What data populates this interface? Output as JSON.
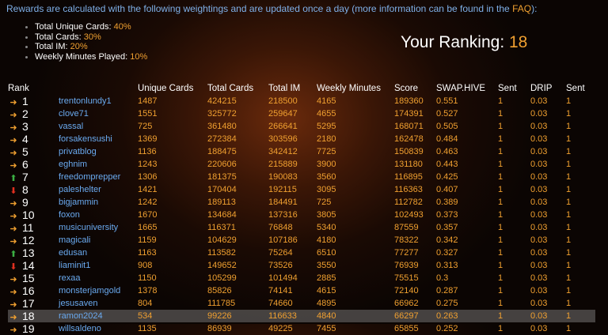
{
  "intro": {
    "text": "Rewards are calculated with the following weightings and are updated once a day (more information can be found in the ",
    "faq_label": "FAQ",
    "end": "):"
  },
  "weights": [
    {
      "label": "Total Unique Cards: ",
      "value": "40%"
    },
    {
      "label": "Total Cards: ",
      "value": "30%"
    },
    {
      "label": "Total IM: ",
      "value": "20%"
    },
    {
      "label": "Weekly Minutes Played: ",
      "value": "10%"
    }
  ],
  "ranking": {
    "label": "Your Ranking: ",
    "value": "18"
  },
  "headers": [
    "Rank",
    "Unique Cards",
    "Total Cards",
    "Total IM",
    "Weekly Minutes",
    "Score",
    "SWAP.HIVE",
    "Sent",
    "DRIP",
    "Sent"
  ],
  "rows": [
    {
      "arrow": "right",
      "rank": "1",
      "name": "trentonlundy1",
      "unique": "1487",
      "total": "424215",
      "im": "218500",
      "minutes": "4165",
      "score": "189360",
      "swap": "0.551",
      "sent": "1",
      "drip": "0.03",
      "sent2": "1"
    },
    {
      "arrow": "right",
      "rank": "2",
      "name": "clove71",
      "unique": "1551",
      "total": "325772",
      "im": "259647",
      "minutes": "4655",
      "score": "174391",
      "swap": "0.527",
      "sent": "1",
      "drip": "0.03",
      "sent2": "1"
    },
    {
      "arrow": "right",
      "rank": "3",
      "name": "vassal",
      "unique": "725",
      "total": "361480",
      "im": "266641",
      "minutes": "5295",
      "score": "168071",
      "swap": "0.505",
      "sent": "1",
      "drip": "0.03",
      "sent2": "1"
    },
    {
      "arrow": "right",
      "rank": "4",
      "name": "forsakensushi",
      "unique": "1369",
      "total": "272384",
      "im": "303596",
      "minutes": "2180",
      "score": "162478",
      "swap": "0.484",
      "sent": "1",
      "drip": "0.03",
      "sent2": "1"
    },
    {
      "arrow": "right",
      "rank": "5",
      "name": "privatblog",
      "unique": "1136",
      "total": "188475",
      "im": "342412",
      "minutes": "7725",
      "score": "150839",
      "swap": "0.463",
      "sent": "1",
      "drip": "0.03",
      "sent2": "1"
    },
    {
      "arrow": "right",
      "rank": "6",
      "name": "eghnim",
      "unique": "1243",
      "total": "220606",
      "im": "215889",
      "minutes": "3900",
      "score": "131180",
      "swap": "0.443",
      "sent": "1",
      "drip": "0.03",
      "sent2": "1"
    },
    {
      "arrow": "up",
      "rank": "7",
      "name": "freedomprepper",
      "unique": "1306",
      "total": "181375",
      "im": "190083",
      "minutes": "3560",
      "score": "116895",
      "swap": "0.425",
      "sent": "1",
      "drip": "0.03",
      "sent2": "1"
    },
    {
      "arrow": "down",
      "rank": "8",
      "name": "paleshelter",
      "unique": "1421",
      "total": "170404",
      "im": "192115",
      "minutes": "3095",
      "score": "116363",
      "swap": "0.407",
      "sent": "1",
      "drip": "0.03",
      "sent2": "1"
    },
    {
      "arrow": "right",
      "rank": "9",
      "name": "bigjammin",
      "unique": "1242",
      "total": "189113",
      "im": "184491",
      "minutes": "725",
      "score": "112782",
      "swap": "0.389",
      "sent": "1",
      "drip": "0.03",
      "sent2": "1"
    },
    {
      "arrow": "right",
      "rank": "10",
      "name": "foxon",
      "unique": "1670",
      "total": "134684",
      "im": "137316",
      "minutes": "3805",
      "score": "102493",
      "swap": "0.373",
      "sent": "1",
      "drip": "0.03",
      "sent2": "1"
    },
    {
      "arrow": "right",
      "rank": "11",
      "name": "musicuniversity",
      "unique": "1665",
      "total": "116371",
      "im": "76848",
      "minutes": "5340",
      "score": "87559",
      "swap": "0.357",
      "sent": "1",
      "drip": "0.03",
      "sent2": "1"
    },
    {
      "arrow": "right",
      "rank": "12",
      "name": "magicali",
      "unique": "1159",
      "total": "104629",
      "im": "107186",
      "minutes": "4180",
      "score": "78322",
      "swap": "0.342",
      "sent": "1",
      "drip": "0.03",
      "sent2": "1"
    },
    {
      "arrow": "up",
      "rank": "13",
      "name": "edusan",
      "unique": "1163",
      "total": "113582",
      "im": "75264",
      "minutes": "6510",
      "score": "77277",
      "swap": "0.327",
      "sent": "1",
      "drip": "0.03",
      "sent2": "1"
    },
    {
      "arrow": "down",
      "rank": "14",
      "name": "liaminit1",
      "unique": "908",
      "total": "149652",
      "im": "73526",
      "minutes": "3550",
      "score": "76939",
      "swap": "0.313",
      "sent": "1",
      "drip": "0.03",
      "sent2": "1"
    },
    {
      "arrow": "right",
      "rank": "15",
      "name": "rexaa",
      "unique": "1150",
      "total": "105299",
      "im": "101494",
      "minutes": "2885",
      "score": "75515",
      "swap": "0.3",
      "sent": "1",
      "drip": "0.03",
      "sent2": "1"
    },
    {
      "arrow": "right",
      "rank": "16",
      "name": "monsterjamgold",
      "unique": "1378",
      "total": "85826",
      "im": "74141",
      "minutes": "4615",
      "score": "72140",
      "swap": "0.287",
      "sent": "1",
      "drip": "0.03",
      "sent2": "1"
    },
    {
      "arrow": "right",
      "rank": "17",
      "name": "jesusaven",
      "unique": "804",
      "total": "111785",
      "im": "74660",
      "minutes": "4895",
      "score": "66962",
      "swap": "0.275",
      "sent": "1",
      "drip": "0.03",
      "sent2": "1"
    },
    {
      "arrow": "right",
      "rank": "18",
      "name": "ramon2024",
      "unique": "534",
      "total": "99226",
      "im": "116633",
      "minutes": "4840",
      "score": "66297",
      "swap": "0.263",
      "sent": "1",
      "drip": "0.03",
      "sent2": "1",
      "highlight": true
    },
    {
      "arrow": "right",
      "rank": "19",
      "name": "willsaldeno",
      "unique": "1135",
      "total": "86939",
      "im": "49225",
      "minutes": "7455",
      "score": "65855",
      "swap": "0.252",
      "sent": "1",
      "drip": "0.03",
      "sent2": "1"
    }
  ],
  "colors": {
    "accent": "#f0a030",
    "link": "#6aaaf0",
    "up": "#3cb043",
    "down": "#e03020"
  }
}
